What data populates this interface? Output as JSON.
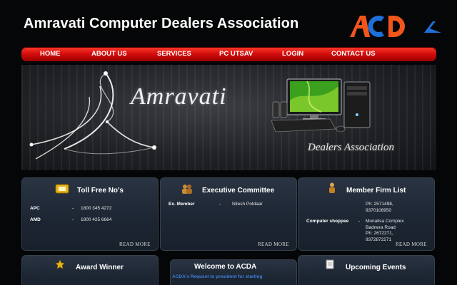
{
  "header": {
    "title": "Amravati Computer Dealers Association",
    "logo_text": "ACD"
  },
  "nav": {
    "items": [
      "HOME",
      "ABOUT US",
      "SERVICES",
      "PC UTSAV",
      "LOGIN",
      "CONTACT US"
    ]
  },
  "banner": {
    "city": "Amravati",
    "subtitle": "Dealers Association"
  },
  "boxes": {
    "toll_free": {
      "title": "Toll Free No's",
      "rows": [
        {
          "key": "APC",
          "dash": "-",
          "value": "1800 345 4272"
        },
        {
          "key": "AMD",
          "dash": "-",
          "value": "1800 425 6664"
        }
      ],
      "read_more": "READ MORE"
    },
    "executive": {
      "title": "Executive Committee",
      "rows": [
        {
          "key": "Ex. Member",
          "dash": "-",
          "value": "Nilesh Potdaar"
        }
      ],
      "read_more": "READ MORE"
    },
    "member_firm": {
      "title": "Member Firm List",
      "top_lines": "Ph: 2571498,\n9370108950",
      "entry_key": "Computer shoppee",
      "entry_dash": "-",
      "entry_lines": "Monalisa Complex\nBadnera Road\nPh: 2672271,\n9372872271",
      "read_more": "READ MORE"
    },
    "award": {
      "title": "Award Winner"
    },
    "welcome": {
      "title": "Welcome to ACDA",
      "text": "ACDA's Request to president for starting"
    },
    "events": {
      "title": "Upcoming Events"
    }
  },
  "colors": {
    "nav_red": "#d20c0c",
    "logo_orange": "#f0561c",
    "logo_blue": "#1e6fd9",
    "box_bg": "#1c2532",
    "link_blue": "#3d7fd9"
  }
}
